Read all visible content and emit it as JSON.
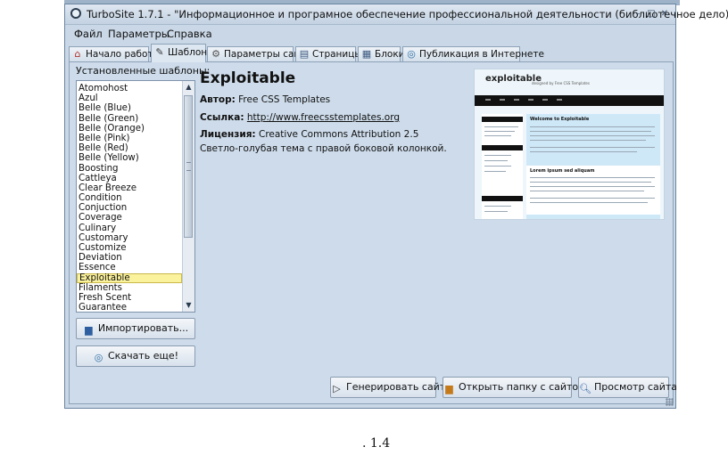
{
  "window": {
    "title": "TurboSite 1.7.1 - \"Информационное и програмное обеспечение профессиональной деятельности (библиотечное дело)\"",
    "controls": {
      "minimize": "–",
      "maximize": "□",
      "close": "✕"
    }
  },
  "menu": [
    "Файл",
    "Параметры",
    "Справка"
  ],
  "tabs": [
    {
      "label": "Начало работы",
      "icon": "home-icon"
    },
    {
      "label": "Шаблон",
      "icon": "brush-icon"
    },
    {
      "label": "Параметры сайта",
      "icon": "gear-icon"
    },
    {
      "label": "Страницы",
      "icon": "pages-icon"
    },
    {
      "label": "Блоки",
      "icon": "blocks-icon"
    },
    {
      "label": "Публикация в Интернете",
      "icon": "globe-icon"
    }
  ],
  "active_tab": "Шаблон",
  "templates": {
    "label": "Установленные шаблоны:",
    "items": [
      "Atomohost",
      "Azul",
      "Belle (Blue)",
      "Belle (Green)",
      "Belle (Orange)",
      "Belle (Pink)",
      "Belle (Red)",
      "Belle (Yellow)",
      "Boosting",
      "Cattleya",
      "Clear Breeze",
      "Condition",
      "Conjuction",
      "Coverage",
      "Culinary",
      "Customary",
      "Customize",
      "Deviation",
      "Essence",
      "Exploitable",
      "Filaments",
      "Fresh Scent",
      "Guarantee"
    ],
    "selected": "Exploitable"
  },
  "left_buttons": {
    "import": "Импортировать...",
    "download": "Скачать еще!"
  },
  "detail": {
    "title": "Exploitable",
    "author_label": "Автор:",
    "author": "Free CSS Templates",
    "link_label": "Ссылка:",
    "link": "http://www.freecsstemplates.org",
    "license_label": "Лицензия:",
    "license": "Creative Commons Attribution 2.5",
    "description": "Светло-голубая тема с правой боковой колонкой."
  },
  "preview": {
    "logo": "exploitable",
    "tagline": "designed by Free CSS Templates",
    "main_title": "Welcome to Exploitable",
    "second_title": "Lorem ipsum sed aliquam"
  },
  "bottom_buttons": {
    "generate": "Генерировать сайт",
    "open_folder": "Открыть папку с сайтом",
    "view": "Просмотр сайта"
  },
  "caption": ". 1.4"
}
